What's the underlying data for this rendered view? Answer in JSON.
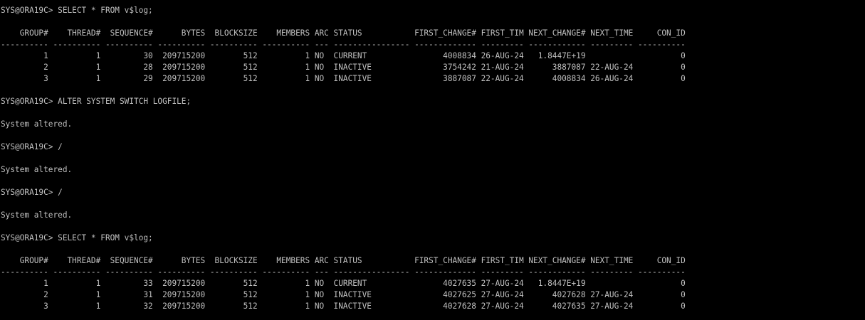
{
  "terminal": {
    "lines": [
      "SYS@ORA19C> SELECT * FROM v$log;",
      "",
      "    GROUP#    THREAD#  SEQUENCE#      BYTES  BLOCKSIZE    MEMBERS ARC STATUS           FIRST_CHANGE# FIRST_TIM NEXT_CHANGE# NEXT_TIME     CON_ID",
      "---------- ---------- ---------- ---------- ---------- ---------- --- ---------------- ------------- --------- ------------ --------- ----------",
      "         1          1         30  209715200        512          1 NO  CURRENT                4008834 26-AUG-24   1.8447E+19                    0",
      "         2          1         28  209715200        512          1 NO  INACTIVE               3754242 21-AUG-24      3887087 22-AUG-24          0",
      "         3          1         29  209715200        512          1 NO  INACTIVE               3887087 22-AUG-24      4008834 26-AUG-24          0",
      "",
      "SYS@ORA19C> ALTER SYSTEM SWITCH LOGFILE;",
      "",
      "System altered.",
      "",
      "SYS@ORA19C> /",
      "",
      "System altered.",
      "",
      "SYS@ORA19C> /",
      "",
      "System altered.",
      "",
      "SYS@ORA19C> SELECT * FROM v$log;",
      "",
      "    GROUP#    THREAD#  SEQUENCE#      BYTES  BLOCKSIZE    MEMBERS ARC STATUS           FIRST_CHANGE# FIRST_TIM NEXT_CHANGE# NEXT_TIME     CON_ID",
      "---------- ---------- ---------- ---------- ---------- ---------- --- ---------------- ------------- --------- ------------ --------- ----------",
      "         1          1         33  209715200        512          1 NO  CURRENT                4027635 27-AUG-24   1.8447E+19                    0",
      "         2          1         31  209715200        512          1 NO  INACTIVE               4027625 27-AUG-24      4027628 27-AUG-24          0",
      "         3          1         32  209715200        512          1 NO  INACTIVE               4027628 27-AUG-24      4027635 27-AUG-24          0"
    ]
  },
  "colors": {
    "background": "#000000",
    "text": "#c0c0c0"
  }
}
